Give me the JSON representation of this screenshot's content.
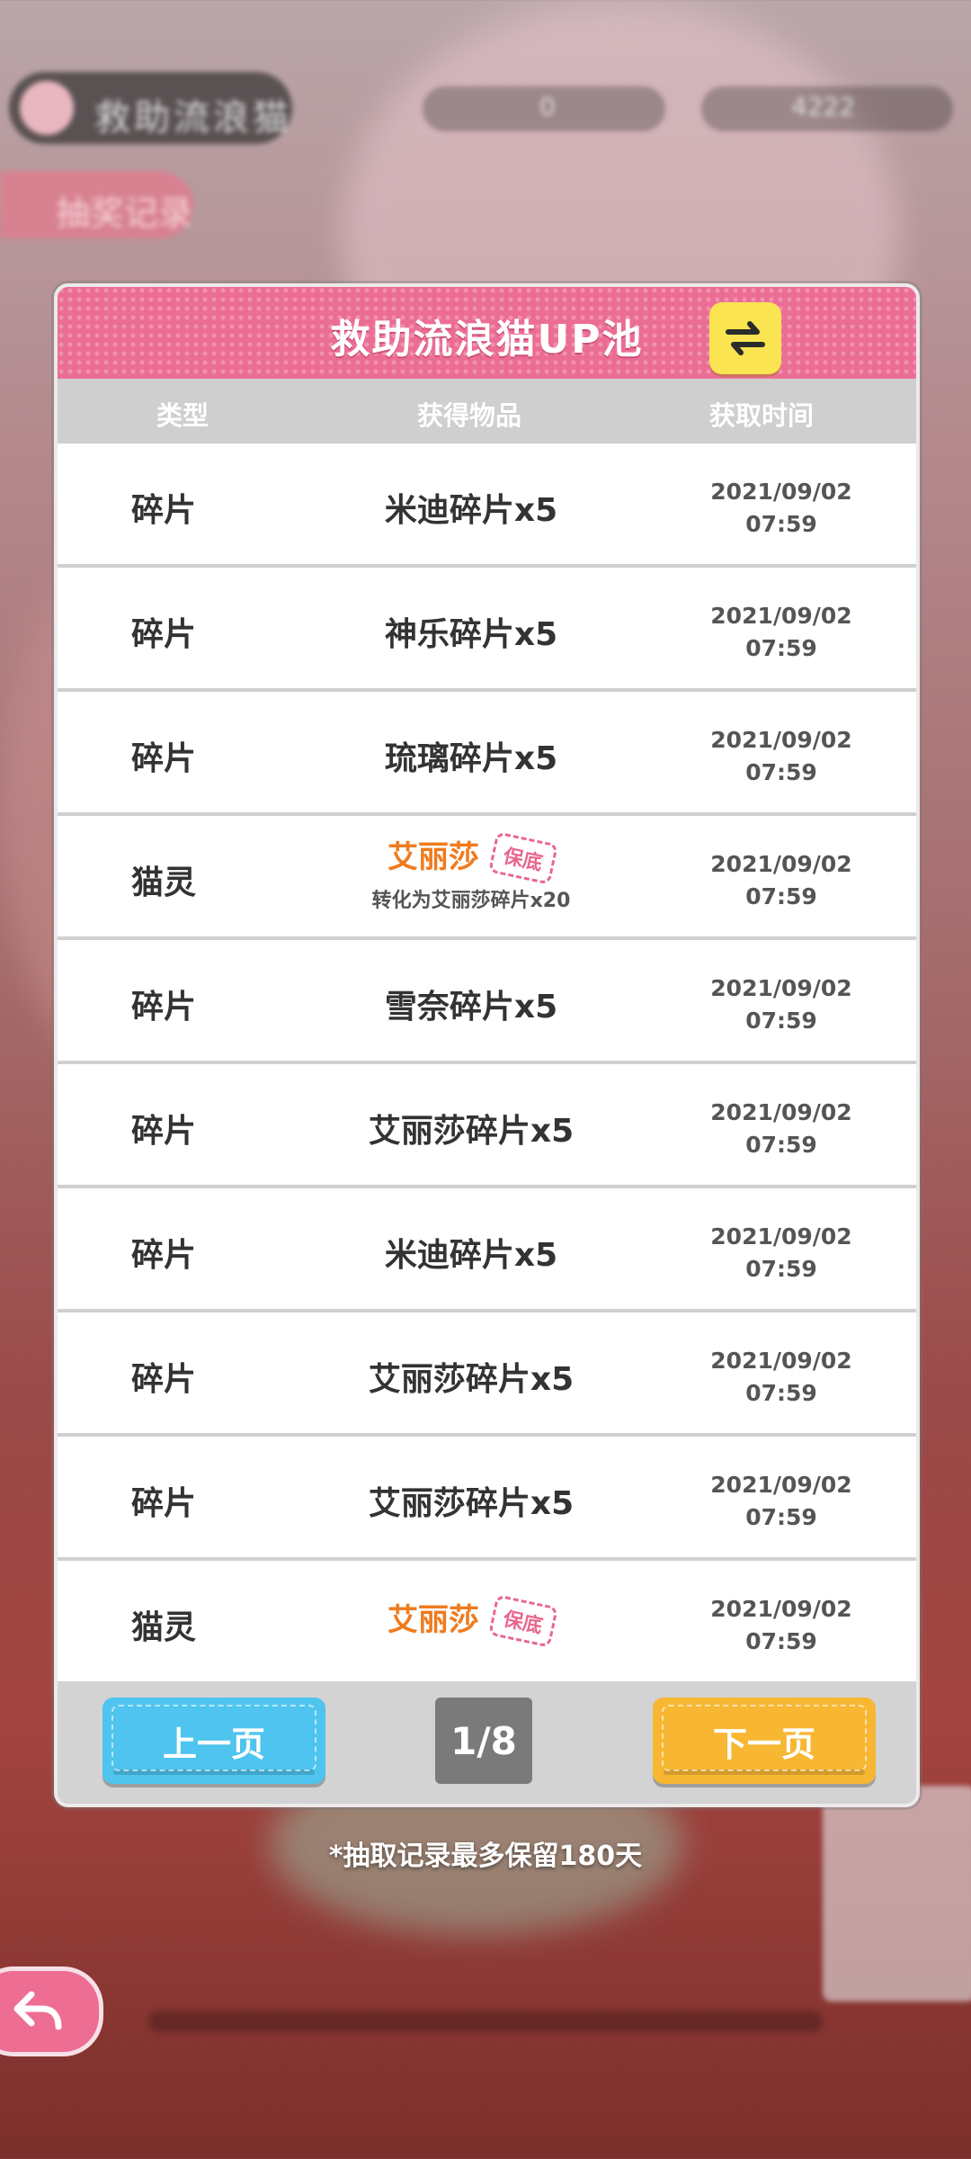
{
  "background": {
    "top_pill_label": "救助流浪猫",
    "tab_label": "抽奖记录",
    "resource_left_value": "0",
    "resource_right_value": "4222"
  },
  "panel": {
    "title": "救助流浪猫UP池",
    "switch_icon": "swap-arrows-icon",
    "columns": {
      "type": "类型",
      "item": "获得物品",
      "time": "获取时间"
    },
    "rows": [
      {
        "type": "碎片",
        "item": "米迪碎片x5",
        "date": "2021/09/02",
        "time": "07:59"
      },
      {
        "type": "碎片",
        "item": "神乐碎片x5",
        "date": "2021/09/02",
        "time": "07:59"
      },
      {
        "type": "碎片",
        "item": "琉璃碎片x5",
        "date": "2021/09/02",
        "time": "07:59"
      },
      {
        "type": "猫灵",
        "item": "艾丽莎",
        "badge": "保底",
        "sub": "转化为艾丽莎碎片x20",
        "date": "2021/09/02",
        "time": "07:59"
      },
      {
        "type": "碎片",
        "item": "雪奈碎片x5",
        "date": "2021/09/02",
        "time": "07:59"
      },
      {
        "type": "碎片",
        "item": "艾丽莎碎片x5",
        "date": "2021/09/02",
        "time": "07:59"
      },
      {
        "type": "碎片",
        "item": "米迪碎片x5",
        "date": "2021/09/02",
        "time": "07:59"
      },
      {
        "type": "碎片",
        "item": "艾丽莎碎片x5",
        "date": "2021/09/02",
        "time": "07:59"
      },
      {
        "type": "碎片",
        "item": "艾丽莎碎片x5",
        "date": "2021/09/02",
        "time": "07:59"
      },
      {
        "type": "猫灵",
        "item": "艾丽莎",
        "badge": "保底",
        "date": "2021/09/02",
        "time": "07:59"
      }
    ],
    "prev_label": "上一页",
    "next_label": "下一页",
    "page_indicator": "1/8"
  },
  "note": "*抽取记录最多保留180天",
  "colors": {
    "header_pink": "#ec6d94",
    "prev_blue": "#4ec4ee",
    "next_yellow": "#f7b733",
    "highlight_orange": "#ef7b1f"
  }
}
